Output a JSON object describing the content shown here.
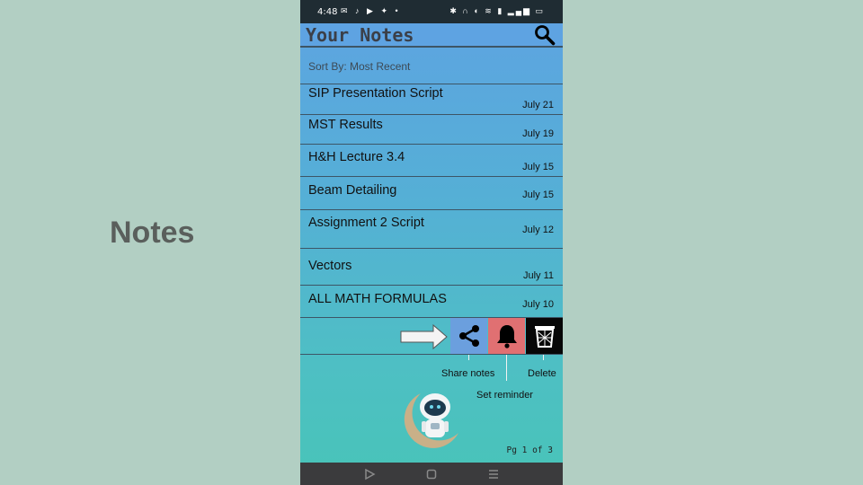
{
  "slide": {
    "title": "Notes"
  },
  "status": {
    "time": "4:48"
  },
  "header": {
    "title": "Your Notes",
    "search_icon": "search-icon"
  },
  "sort": {
    "label": "Sort By: Most Recent"
  },
  "notes": [
    {
      "title": "SIP Presentation Script",
      "date": "July 21"
    },
    {
      "title": "MST Results",
      "date": "July 19"
    },
    {
      "title": "H&H Lecture 3.4",
      "date": "July 15"
    },
    {
      "title": "Beam Detailing",
      "date": "July 15"
    },
    {
      "title": "Assignment 2 Script",
      "date": "July 12"
    },
    {
      "title": "Vectors",
      "date": "July 11"
    },
    {
      "title": "ALL MATH FORMULAS",
      "date": "July 10"
    }
  ],
  "actions": {
    "share_label": "Share notes",
    "reminder_label": "Set reminder",
    "delete_label": "Delete",
    "colors": {
      "share": "#6b9fde",
      "reminder": "#e07072",
      "delete": "#070707"
    }
  },
  "footer": {
    "page": "Pg 1 of 3"
  },
  "colors": {
    "appbar": "#5ea3e2",
    "background_top": "#5ea3e2",
    "background_bottom": "#48c4b8"
  }
}
